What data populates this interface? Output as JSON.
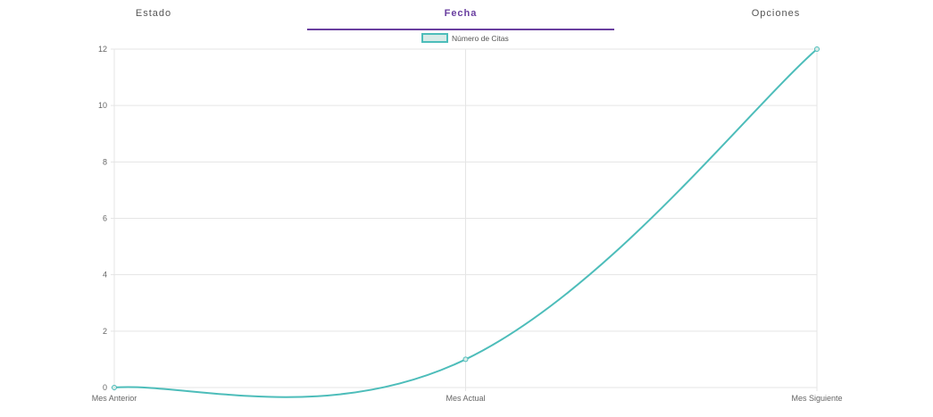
{
  "tabs": [
    {
      "label": "Estado",
      "active": false
    },
    {
      "label": "Fecha",
      "active": true
    },
    {
      "label": "Opciones",
      "active": false
    }
  ],
  "colors": {
    "accent": "#6a3fa0",
    "series": "#4dbdba",
    "series_fill": "#d8ebe8",
    "grid": "#e5e5e5"
  },
  "chart_data": {
    "type": "line",
    "categories": [
      "Mes Anterior",
      "Mes Actual",
      "Mes Siguiente"
    ],
    "series": [
      {
        "name": "Número de Citas",
        "values": [
          0,
          1,
          12
        ]
      }
    ],
    "ylim": [
      0,
      12
    ],
    "yticks": [
      0,
      2,
      4,
      6,
      8,
      10,
      12
    ],
    "legend": "top",
    "grid": true
  }
}
